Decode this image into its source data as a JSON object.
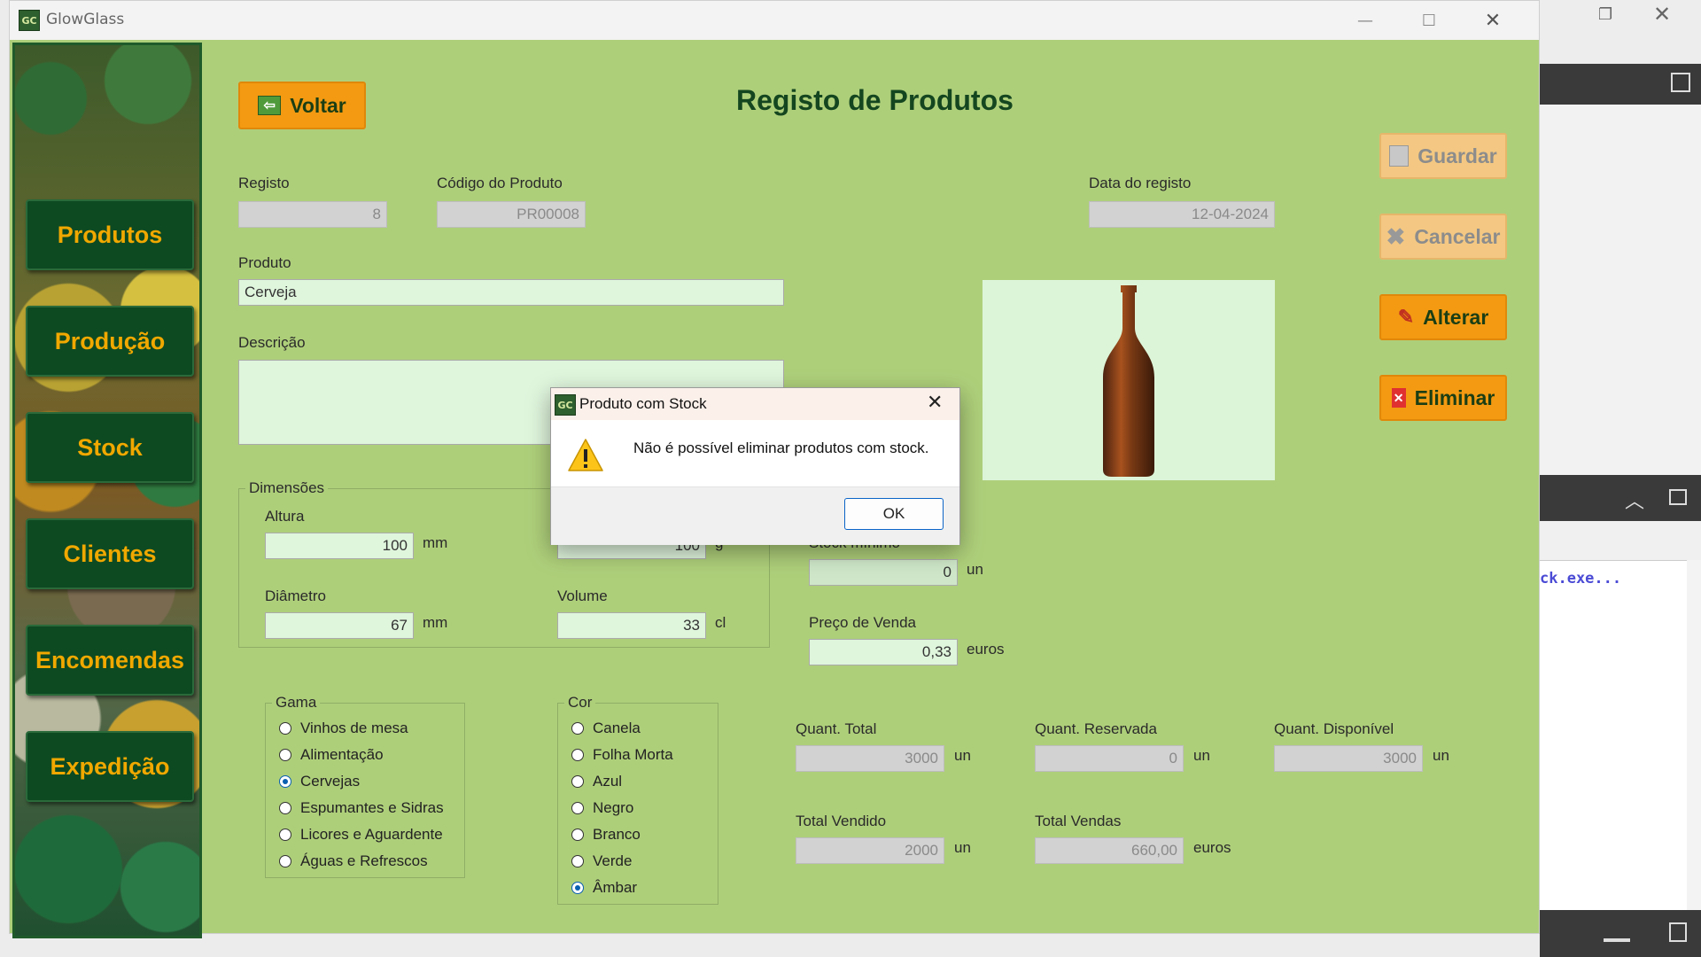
{
  "window": {
    "title": "GlowGlass",
    "app_icon": "GC"
  },
  "sidebar": {
    "items": [
      {
        "label": "Produtos"
      },
      {
        "label": "Produção"
      },
      {
        "label": "Stock"
      },
      {
        "label": "Clientes"
      },
      {
        "label": "Encomendas"
      },
      {
        "label": "Expedição"
      }
    ]
  },
  "header": {
    "back_label": "Voltar",
    "title": "Registo de Produtos"
  },
  "actions": {
    "save": "Guardar",
    "cancel": "Cancelar",
    "edit": "Alterar",
    "delete": "Eliminar"
  },
  "form": {
    "registo": {
      "label": "Registo",
      "value": "8"
    },
    "codigo": {
      "label": "Código do Produto",
      "value": "PR00008"
    },
    "data": {
      "label": "Data do registo",
      "value": "12-04-2024"
    },
    "produto": {
      "label": "Produto",
      "value": "Cerveja"
    },
    "descricao": {
      "label": "Descrição",
      "value": ""
    },
    "dimensoes": {
      "label": "Dimensões",
      "altura": {
        "label": "Altura",
        "value": "100",
        "unit": "mm"
      },
      "peso": {
        "value": "100",
        "unit": "g"
      },
      "diametro": {
        "label": "Diâmetro",
        "value": "67",
        "unit": "mm"
      },
      "volume": {
        "label": "Volume",
        "value": "33",
        "unit": "cl"
      }
    },
    "stock_minimo": {
      "label": "Stock mínimo",
      "value": "0",
      "unit": "un"
    },
    "preco": {
      "label": "Preço de Venda",
      "value": "0,33",
      "unit": "euros"
    },
    "gama": {
      "label": "Gama",
      "options": [
        "Vinhos de mesa",
        "Alimentação",
        "Cervejas",
        "Espumantes e Sidras",
        "Licores e Aguardente",
        "Águas e Refrescos"
      ],
      "selected": "Cervejas"
    },
    "cor": {
      "label": "Cor",
      "options": [
        "Canela",
        "Folha Morta",
        "Azul",
        "Negro",
        "Branco",
        "Verde",
        "Âmbar"
      ],
      "selected": "Âmbar"
    },
    "quant_total": {
      "label": "Quant. Total",
      "value": "3000",
      "unit": "un"
    },
    "quant_reservada": {
      "label": "Quant. Reservada",
      "value": "0",
      "unit": "un"
    },
    "quant_disponivel": {
      "label": "Quant. Disponível",
      "value": "3000",
      "unit": "un"
    },
    "total_vendido": {
      "label": "Total Vendido",
      "value": "2000",
      "unit": "un"
    },
    "total_vendas": {
      "label": "Total Vendas",
      "value": "660,00",
      "unit": "euros"
    }
  },
  "dialog": {
    "title": "Produto com Stock",
    "message": "Não é possível eliminar produtos com stock.",
    "ok": "OK"
  },
  "background_app": {
    "code_text": "ck.exe..."
  },
  "colors": {
    "client_bg": "#aecf7a",
    "nav_bg": "#0d4a22",
    "nav_text": "#f0a800",
    "action_enabled": "#f39a12",
    "action_disabled": "#f4c882"
  }
}
